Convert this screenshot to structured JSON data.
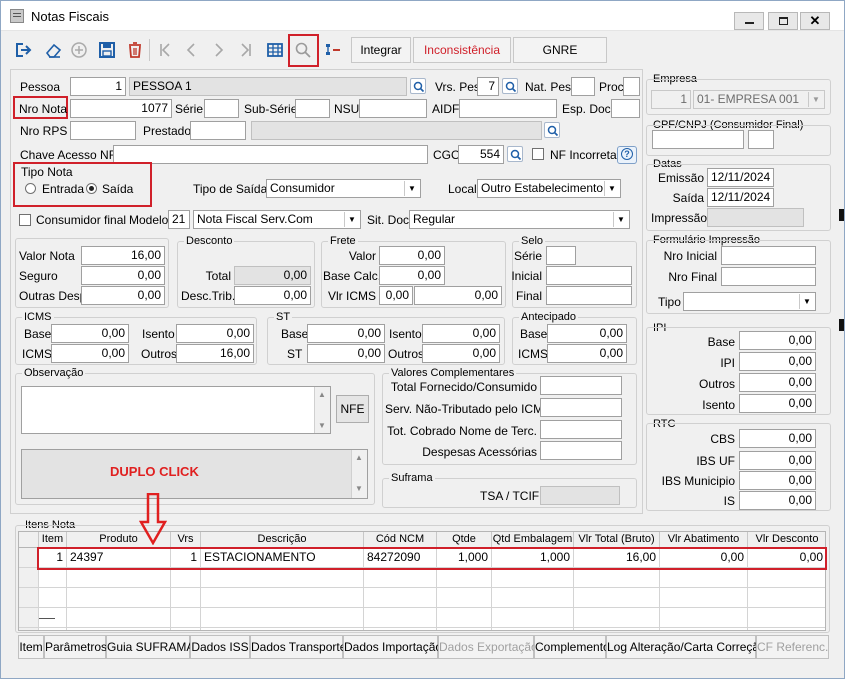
{
  "window": {
    "title": "Notas Fiscais"
  },
  "toolbar": {
    "integrar": "Integrar",
    "inconsistencia": "Inconsistência",
    "gnre": "GNRE"
  },
  "pessoa": {
    "label": "Pessoa",
    "code": "1",
    "name": "PESSOA 1",
    "vrs_label": "Vrs. Pes",
    "vrs": "7",
    "natpes_label": "Nat. Pes.",
    "natpes": "",
    "proc_label": "Proc.",
    "proc": ""
  },
  "nronota": {
    "label": "Nro Nota",
    "value": "1077",
    "serie_label": "Série",
    "serie": "",
    "subserie_label": "Sub-Série",
    "subserie": "",
    "nsu_label": "NSU",
    "nsu": "",
    "aidf_label": "AIDF",
    "aidf": "",
    "espdoc_label": "Esp. Doc.",
    "espdoc": ""
  },
  "nrorps": {
    "label": "Nro RPS",
    "value": "",
    "prestador_label": "Prestador",
    "prestador": "",
    "prestador_name": ""
  },
  "chave": {
    "label": "Chave Acesso NFe",
    "value": "",
    "cgo_label": "CGO",
    "cgo": "554",
    "nf_incorreta": "NF Incorreta",
    "help": "?"
  },
  "tiponota": {
    "title": "Tipo Nota",
    "entrada": "Entrada",
    "saida": "Saída"
  },
  "tiposaida": {
    "label": "Tipo de Saída",
    "value": "Consumidor"
  },
  "local": {
    "label": "Local",
    "value": "Outro Estabelecimento"
  },
  "consumidor": {
    "label": "Consumidor final",
    "modelo_label": "Modelo",
    "modelo_code": "21",
    "modelo_name": "Nota Fiscal Serv.Com",
    "sitdoc_label": "Sit. Doc.",
    "sitdoc": "Regular"
  },
  "valores": {
    "valor_nota_label": "Valor Nota",
    "valor_nota": "16,00",
    "seguro_label": "Seguro",
    "seguro": "0,00",
    "outras_label": "Outras Desp.",
    "outras": "0,00"
  },
  "desconto": {
    "title": "Desconto",
    "total_label": "Total",
    "total": "0,00",
    "desctrib_label": "Desc.Trib.",
    "desctrib": "0,00"
  },
  "frete": {
    "title": "Frete",
    "valor_label": "Valor",
    "valor": "0,00",
    "basecalc_label": "Base Calc.",
    "basecalc": "0,00",
    "vlricms_label": "Vlr ICMS",
    "vlricms_a": "0,00",
    "vlricms_b": "0,00"
  },
  "selo": {
    "title": "Selo",
    "serie_label": "Série",
    "serie": "",
    "inicial_label": "Inicial",
    "inicial": "",
    "final_label": "Final",
    "final": ""
  },
  "icms": {
    "title": "ICMS",
    "base_label": "Base",
    "base": "0,00",
    "icms_label": "ICMS",
    "icms": "0,00",
    "isento_label": "Isento",
    "isento": "0,00",
    "outros_label": "Outros",
    "outros": "16,00"
  },
  "st": {
    "title": "ST",
    "base_label": "Base",
    "base": "0,00",
    "st_label": "ST",
    "st": "0,00",
    "isento_label": "Isento",
    "isento": "0,00",
    "outros_label": "Outros",
    "outros": "0,00"
  },
  "antecipado": {
    "title": "Antecipado",
    "base_label": "Base",
    "base": "0,00",
    "icms_label": "ICMS",
    "icms": "0,00"
  },
  "observacao": {
    "title": "Observação",
    "text": "",
    "nfe_button": "NFE",
    "annotation": "DUPLO CLICK"
  },
  "complementares": {
    "title": "Valores Complementares",
    "total_fornecido": "Total Fornecido/Consumido",
    "serv_nao_trib": "Serv. Não-Tributado pelo ICMS",
    "tot_cobrado": "Tot. Cobrado Nome de Terc.",
    "despesas": "Despesas Acessórias"
  },
  "suframa": {
    "title": "Suframa",
    "tsa_label": "TSA / TCIF",
    "tsa": ""
  },
  "empresa": {
    "title": "Empresa",
    "code": "1",
    "name": "01- EMPRESA 001"
  },
  "cpfcnpj": {
    "title": "CPF/CNPJ (Consumidor Final)"
  },
  "datas": {
    "title": "Datas",
    "emissao_label": "Emissão",
    "emissao": "12/11/2024",
    "saida_label": "Saída",
    "saida": "12/11/2024",
    "impressao_label": "Impressão",
    "impressao": ""
  },
  "formulario": {
    "title": "Formulário Impressão",
    "nro_inicial": "Nro Inicial",
    "nro_final": "Nro Final",
    "tipo": "Tipo"
  },
  "ipi": {
    "title": "IPI",
    "base_label": "Base",
    "base": "0,00",
    "ipi_label": "IPI",
    "ipi": "0,00",
    "outros_label": "Outros",
    "outros": "0,00",
    "isento_label": "Isento",
    "isento": "0,00"
  },
  "rtc": {
    "title": "RTC",
    "cbs_label": "CBS",
    "cbs": "0,00",
    "ibsuf_label": "IBS UF",
    "ibsuf": "0,00",
    "ibsmun_label": "IBS Municipio",
    "ibsmun": "0,00",
    "is_label": "IS",
    "is": "0,00"
  },
  "itens": {
    "title": "Itens Nota",
    "columns": [
      "Item",
      "Produto",
      "Vrs",
      "Descrição",
      "Cód NCM",
      "Qtde",
      "Qtd Embalagem",
      "Vlr Total (Bruto)",
      "Vlr Abatimento",
      "Vlr Desconto"
    ],
    "rows": [
      [
        "1",
        "24397",
        "1",
        "ESTACIONAMENTO",
        "84272090",
        "1,000",
        "1,000",
        "16,00",
        "0,00",
        "0,00"
      ]
    ]
  },
  "tabs": [
    "Item",
    "Parâmetros",
    "Guia SUFRAMA",
    "Dados ISS",
    "Dados Transporte",
    "Dados Importação",
    "Dados Exportação",
    "Complemento",
    "Log Alteração/Carta Correção",
    "CF Referenc."
  ],
  "colors": {
    "highlight": "#d0202a",
    "annotation": "#e02020",
    "toolbar_icon": "#1f5fa8",
    "delete_icon": "#c0392b"
  }
}
